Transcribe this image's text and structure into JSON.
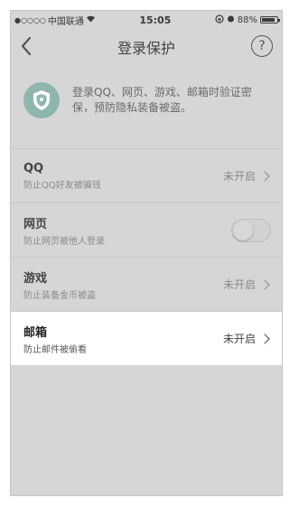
{
  "status_bar": {
    "signal_dots": "●○○○○",
    "carrier": "中国联通",
    "time": "15:05",
    "battery_percent": "88%",
    "battery_level": 0.88
  },
  "nav": {
    "title": "登录保护",
    "back_icon": "chevron-left-icon",
    "help_icon": "question-circle-icon",
    "help_symbol": "?"
  },
  "banner": {
    "text": "登录QQ、网页、游戏、邮箱时验证密保，预防隐私装备被盗。",
    "icon": "shield-icon"
  },
  "items": [
    {
      "title": "QQ",
      "subtitle": "防止QQ好友被骗钱",
      "status": "未开启",
      "control": "chevron"
    },
    {
      "title": "网页",
      "subtitle": "防止网页被他人登录",
      "control": "toggle",
      "toggle_on": false
    },
    {
      "title": "游戏",
      "subtitle": "防止装备金币被盗",
      "status": "未开启",
      "control": "chevron"
    },
    {
      "title": "邮箱",
      "subtitle": "防止邮件被偷看",
      "status": "未开启",
      "control": "chevron",
      "highlighted": true
    }
  ]
}
